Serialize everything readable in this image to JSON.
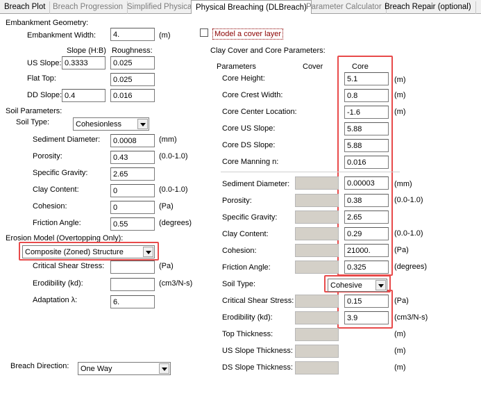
{
  "tabs": [
    {
      "label": "Breach Plot",
      "active": false
    },
    {
      "label": "Breach Progression",
      "active": false
    },
    {
      "label": "Simplified Physical",
      "active": false
    },
    {
      "label": "Physical Breaching (DLBreach)",
      "active": true
    },
    {
      "label": "Parameter Calculator",
      "active": false
    },
    {
      "label": "Breach Repair (optional)",
      "active": false
    }
  ],
  "embankment": {
    "header": "Embankment Geometry:",
    "width_label": "Embankment Width:",
    "width_value": "4.",
    "width_unit": "(m)",
    "col_slope": "Slope (H:B)",
    "col_roughness": "Roughness:",
    "us_slope_label": "US Slope:",
    "us_slope_value": "0.3333",
    "us_roughness": "0.025",
    "flat_top_label": "Flat Top:",
    "flat_top_roughness": "0.025",
    "ds_slope_label": "DD Slope:",
    "ds_slope_value": "0.4",
    "ds_roughness": "0.016"
  },
  "soil": {
    "header": "Soil Parameters:",
    "type_label": "Soil Type:",
    "type_value": "Cohesionless",
    "sed_diam_label": "Sediment Diameter:",
    "sed_diam_value": "0.0008",
    "sed_diam_unit": "(mm)",
    "porosity_label": "Porosity:",
    "porosity_value": "0.43",
    "porosity_unit": "(0.0-1.0)",
    "sg_label": "Specific Gravity:",
    "sg_value": "2.65",
    "clay_label": "Clay Content:",
    "clay_value": "0",
    "clay_unit": "(0.0-1.0)",
    "cohesion_label": "Cohesion:",
    "cohesion_value": "0",
    "cohesion_unit": "(Pa)",
    "friction_label": "Friction Angle:",
    "friction_value": "0.55",
    "friction_unit": "(degrees)"
  },
  "erosion": {
    "header": "Erosion Model (Overtopping Only):",
    "model_value": "Composite (Zoned) Structure",
    "css_label": "Critical Shear Stress:",
    "css_unit": "(Pa)",
    "erod_label": "Erodibility (kd):",
    "erod_unit": "(cm3/N-s)",
    "adapt_label": "Adaptation λ:",
    "adapt_value": "6."
  },
  "breach_direction": {
    "label": "Breach Direction:",
    "value": "One Way"
  },
  "cover": {
    "checkbox_label": "Model a cover layer",
    "header": "Clay Cover and Core Parameters:",
    "col_params": "Parameters",
    "col_cover": "Cover",
    "col_core": "Core",
    "rows": [
      {
        "label": "Core Height:",
        "core": "5.1",
        "unit": "(m)",
        "has_cover": false
      },
      {
        "label": "Core Crest Width:",
        "core": "0.8",
        "unit": "(m)",
        "has_cover": false
      },
      {
        "label": "Core Center Location:",
        "core": "-1.6",
        "unit": "(m)",
        "has_cover": false
      },
      {
        "label": "Core US Slope:",
        "core": "5.88",
        "unit": "",
        "has_cover": false
      },
      {
        "label": "Core DS Slope:",
        "core": "5.88",
        "unit": "",
        "has_cover": false
      },
      {
        "label": "Core Manning n:",
        "core": "0.016",
        "unit": "",
        "has_cover": false
      },
      {
        "label": "Sediment Diameter:",
        "core": "0.00003",
        "unit": "(mm)",
        "has_cover": true
      },
      {
        "label": "Porosity:",
        "core": "0.38",
        "unit": "(0.0-1.0)",
        "has_cover": true
      },
      {
        "label": "Specific Gravity:",
        "core": "2.65",
        "unit": "",
        "has_cover": true
      },
      {
        "label": "Clay Content:",
        "core": "0.29",
        "unit": "(0.0-1.0)",
        "has_cover": true
      },
      {
        "label": "Cohesion:",
        "core": "21000.",
        "unit": "(Pa)",
        "has_cover": true
      },
      {
        "label": "Friction Angle:",
        "core": "0.325",
        "unit": "(degrees)",
        "has_cover": true
      }
    ],
    "soil_type_label": "Soil Type:",
    "soil_type_value": "Cohesive",
    "css_label": "Critical Shear Stress:",
    "css_core": "0.15",
    "css_unit": "(Pa)",
    "erod_label": "Erodibility (kd):",
    "erod_core": "3.9",
    "erod_unit": "(cm3/N-s)",
    "top_thick_label": "Top Thickness:",
    "top_thick_unit": "(m)",
    "us_thick_label": "US Slope Thickness:",
    "us_thick_unit": "(m)",
    "ds_thick_label": "DS Slope Thickness:",
    "ds_thick_unit": "(m)"
  },
  "colors": {
    "highlight": "#e84a4a",
    "cover_label": "#8b0000",
    "disabled": "#d4d0c8"
  }
}
